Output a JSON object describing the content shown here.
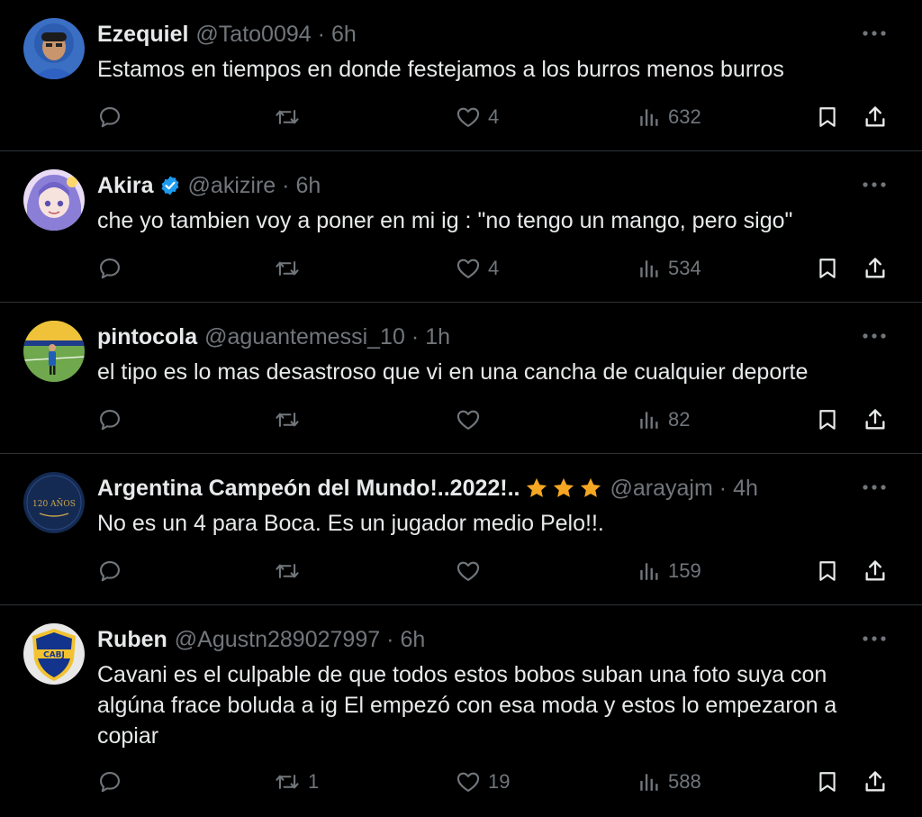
{
  "colors": {
    "background": "#000000",
    "text": "#e7e9ea",
    "muted": "#71767b",
    "divider": "#2f3336",
    "verified": "#1d9bf0",
    "star": "#f5a623"
  },
  "icons": {
    "reply": "reply-icon",
    "retweet": "retweet-icon",
    "like": "heart-icon",
    "views": "views-icon",
    "bookmark": "bookmark-icon",
    "share": "share-icon",
    "more": "more-icon"
  },
  "tweets": [
    {
      "name": "Ezequiel",
      "handle": "@Tato0094",
      "dot": "·",
      "time": "6h",
      "text": "Estamos en tiempos en donde festejamos a los burros menos burros",
      "replies": "",
      "retweets": "",
      "likes": "4",
      "views": "632"
    },
    {
      "name": "Akira",
      "handle": "@akizire",
      "dot": "·",
      "time": "6h",
      "verified": true,
      "text": "che yo tambien voy a poner en mi ig : \"no tengo un mango, pero sigo\"",
      "replies": "",
      "retweets": "",
      "likes": "4",
      "views": "534"
    },
    {
      "name": "pintocola",
      "handle": "@aguantemessi_10",
      "dot": "·",
      "time": "1h",
      "text": "el tipo es lo mas desastroso que vi en una cancha de cualquier deporte",
      "replies": "",
      "retweets": "",
      "likes": "",
      "views": "82"
    },
    {
      "name": "Argentina Campeón del Mundo!..2022!..",
      "handle": "@arayajm",
      "dot": "·",
      "time": "4h",
      "stars": 3,
      "avatar_text": "120 AÑOS",
      "text": "No es un 4 para Boca. Es un jugador medio Pelo!!.",
      "replies": "",
      "retweets": "",
      "likes": "",
      "views": "159"
    },
    {
      "name": "Ruben",
      "handle": "@Agustn289027997",
      "dot": "·",
      "time": "6h",
      "avatar_text": "CABJ",
      "text": "Cavani es el culpable de que todos estos bobos suban una foto suya con algúna frace boluda a ig El empezó con esa moda y estos lo empezaron a copiar",
      "replies": "",
      "retweets": "1",
      "likes": "19",
      "views": "588"
    }
  ]
}
